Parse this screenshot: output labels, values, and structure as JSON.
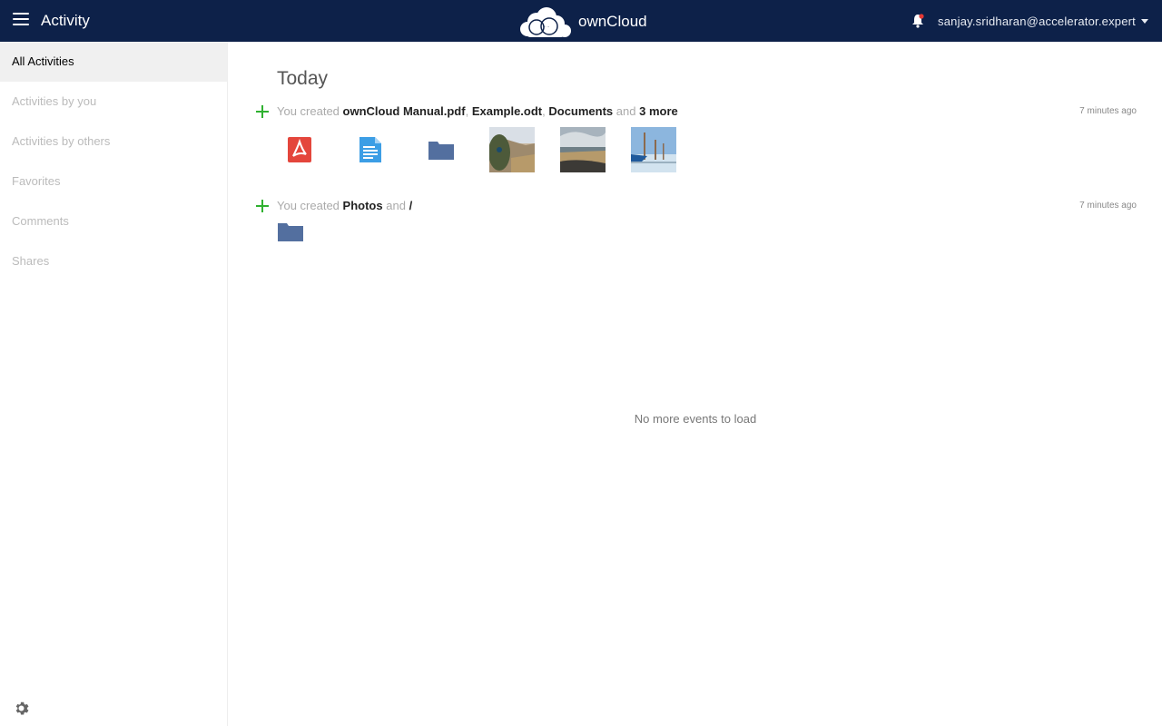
{
  "header": {
    "app_title": "Activity",
    "brand": "ownCloud",
    "user_email": "sanjay.sridharan@accelerator.expert",
    "bg_color": "#0d2149"
  },
  "sidebar": {
    "items": [
      {
        "label": "All Activities",
        "active": true
      },
      {
        "label": "Activities by you",
        "active": false
      },
      {
        "label": "Activities by others",
        "active": false
      },
      {
        "label": "Favorites",
        "active": false
      },
      {
        "label": "Comments",
        "active": false
      },
      {
        "label": "Shares",
        "active": false
      }
    ]
  },
  "main": {
    "day_title": "Today",
    "activities": [
      {
        "prefix": "You created",
        "items": [
          "ownCloud Manual.pdf",
          "Example.odt",
          "Documents"
        ],
        "and_word": "and",
        "more": "3 more",
        "time": "7 minutes ago",
        "previews": [
          "pdf-icon",
          "text-document-icon",
          "folder-icon",
          "photo-thumbnail",
          "photo-thumbnail",
          "photo-thumbnail"
        ]
      },
      {
        "prefix": "You created",
        "items": [
          "Photos"
        ],
        "and_word": "and",
        "more": "/",
        "time": "7 minutes ago",
        "previews": [
          "folder-icon"
        ]
      }
    ],
    "no_more_text": "No more events to load"
  }
}
